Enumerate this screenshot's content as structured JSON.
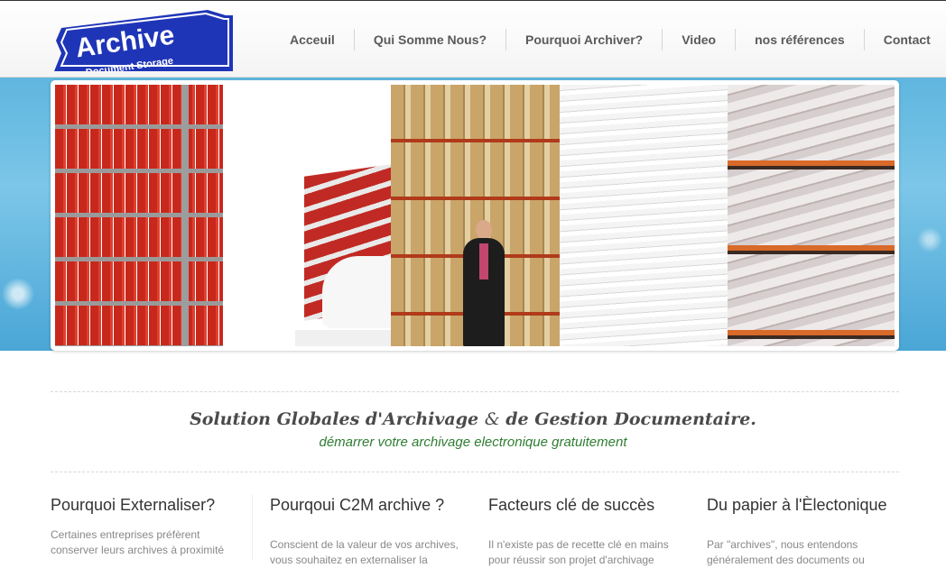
{
  "logo": {
    "word": "Archive",
    "tagline": "Document Storage",
    "colors": {
      "blue": "#1f35b8",
      "white": "#ffffff"
    }
  },
  "nav": {
    "items": [
      {
        "label": "Acceuil"
      },
      {
        "label": "Qui Somme Nous?"
      },
      {
        "label": "Pourquoi Archiver?"
      },
      {
        "label": "Video"
      },
      {
        "label": "nos références"
      },
      {
        "label": "Contact"
      }
    ]
  },
  "banner": {
    "accent": "#5fb6df"
  },
  "intro": {
    "title_part1": "Solution Globales d'Archivage",
    "title_amp": "&",
    "title_part2": "de Gestion Documentaire.",
    "subtitle": "démarrer votre archivage electronique gratuitement",
    "subtitle_color": "#2e7d32"
  },
  "columns": [
    {
      "heading": "Pourquoi Externaliser?",
      "text_line1": "Certaines entreprises préfèrent",
      "text_line2": "conserver leurs archives à proximité"
    },
    {
      "heading": "Pourqoui C2M archive ?",
      "text_line1": "Conscient de la valeur de vos archives,",
      "text_line2": "vous souhaitez en externaliser la"
    },
    {
      "heading": "Facteurs clé de succès",
      "text_line1": "Il n'existe pas de recette clé en mains",
      "text_line2": "pour réussir son projet d'archivage"
    },
    {
      "heading": "Du papier à l'Èlectonique",
      "text_line1": "Par \"archives\", nous entendons",
      "text_line2": "généralement des documents ou"
    }
  ]
}
